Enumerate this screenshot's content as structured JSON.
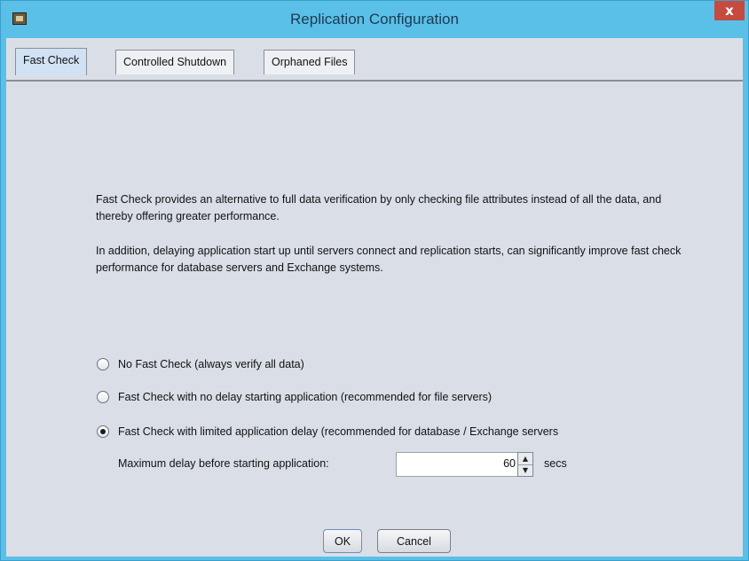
{
  "window": {
    "title": "Replication Configuration",
    "close_label": "x"
  },
  "tabs": [
    {
      "label": "Fast Check",
      "active": true
    },
    {
      "label": "Controlled Shutdown",
      "active": false
    },
    {
      "label": "Orphaned Files",
      "active": false
    }
  ],
  "description": {
    "para1": "Fast Check provides an alternative to full data verification by only checking file attributes instead of all the data, and thereby offering greater performance.",
    "para2": "In addition, delaying application start up until servers connect and replication starts, can significantly improve fast check performance for database servers and Exchange systems."
  },
  "options": [
    {
      "label": "No Fast Check (always verify all data)",
      "checked": false
    },
    {
      "label": "Fast Check with no delay starting application (recommended for file servers)",
      "checked": false
    },
    {
      "label": "Fast Check with limited application delay (recommended for database / Exchange servers",
      "checked": true
    }
  ],
  "delay": {
    "label": "Maximum delay before starting application:",
    "value": "60",
    "unit": "secs"
  },
  "buttons": {
    "ok": "OK",
    "cancel": "Cancel"
  },
  "colors": {
    "titlebar": "#5ac0e8",
    "client": "#dadfe7",
    "close": "#c74a3f",
    "active_tab": "#d0e2f4"
  }
}
